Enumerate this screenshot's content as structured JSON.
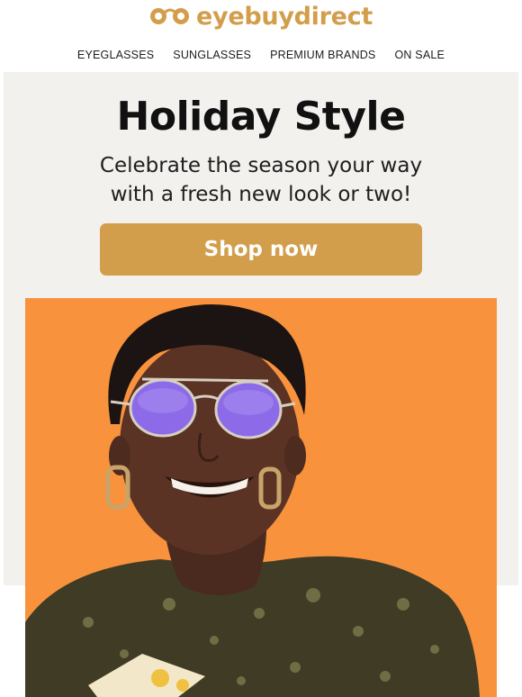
{
  "brand": {
    "name": "eyebuydirect",
    "color": "#d29e4b"
  },
  "nav": {
    "items": [
      {
        "label": "EYEGLASSES"
      },
      {
        "label": "SUNGLASSES"
      },
      {
        "label": "PREMIUM BRANDS"
      },
      {
        "label": "ON SALE"
      }
    ]
  },
  "hero": {
    "title": "Holiday Style",
    "subtitle_line1": "Celebrate the season your way",
    "subtitle_line2": "with a fresh new look or two!",
    "cta_label": "Shop now",
    "background": "#f3f1ee"
  },
  "photo": {
    "background": "#f9923c",
    "lens_color": "#8d6ae8"
  }
}
